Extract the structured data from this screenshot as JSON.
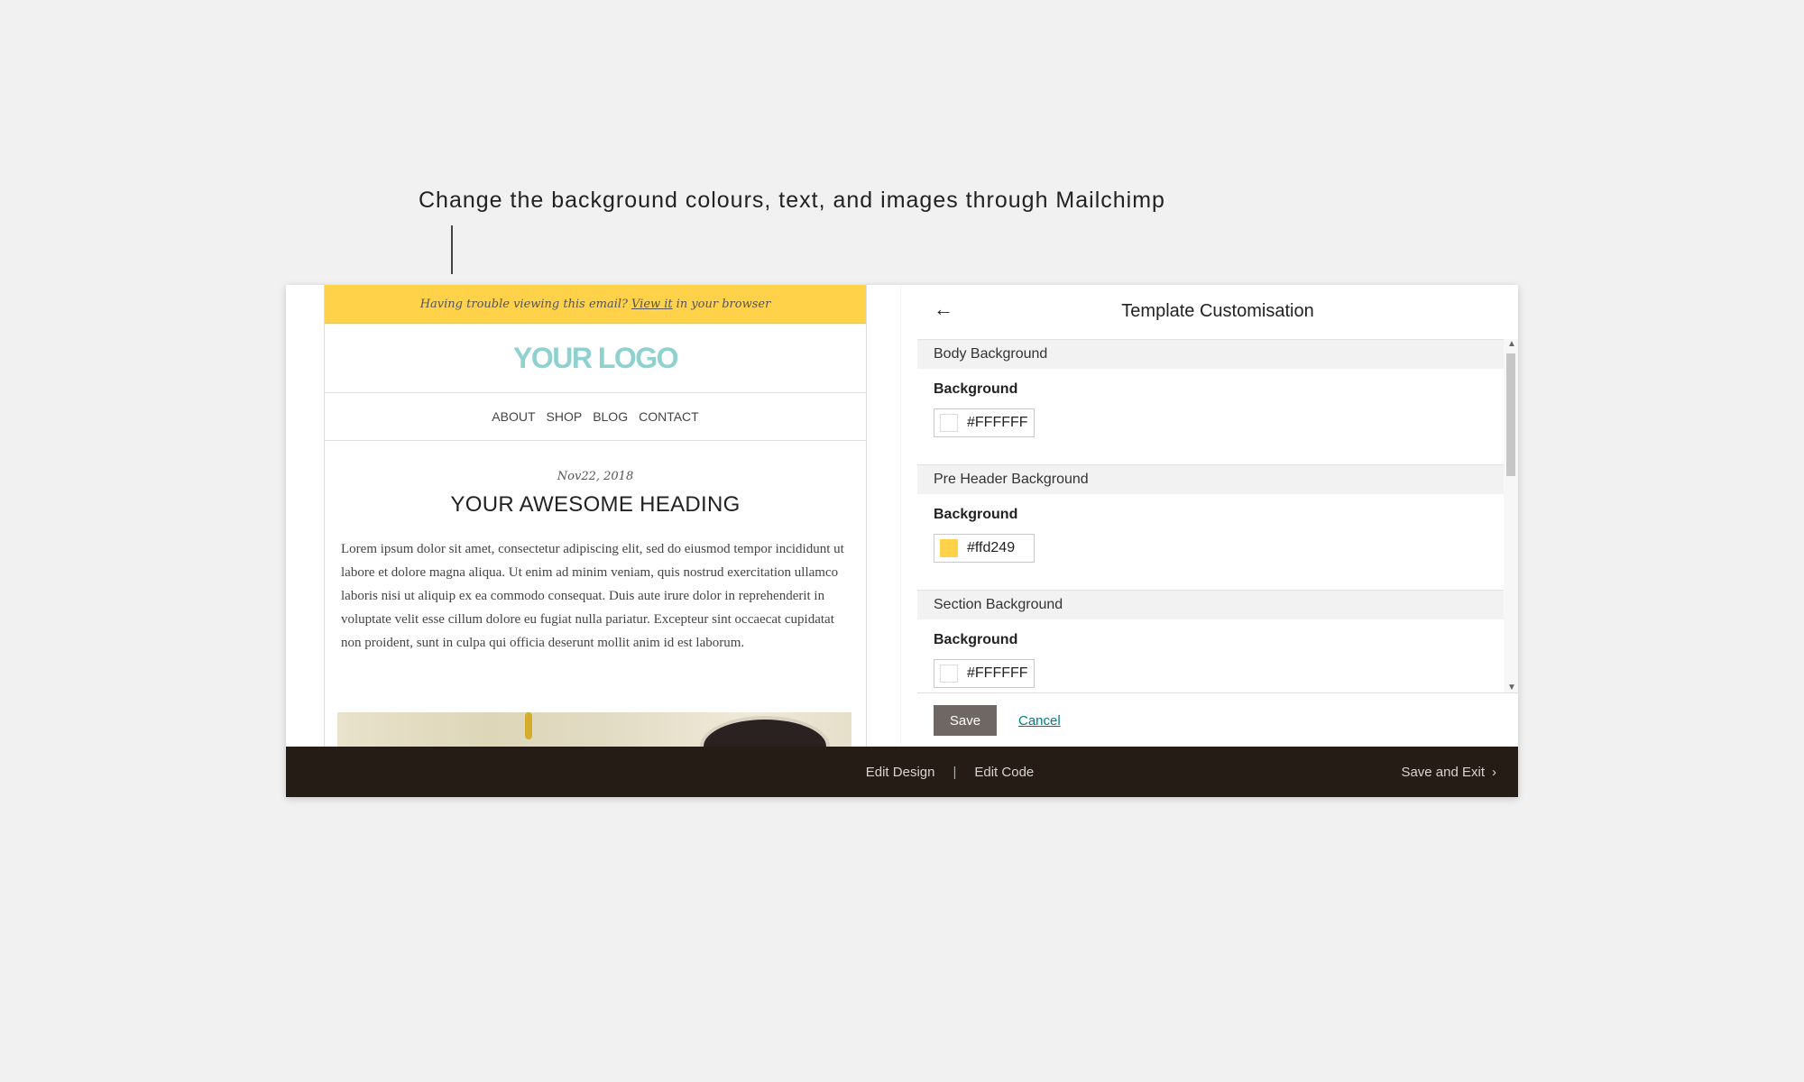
{
  "callout": {
    "text": "Change the background colours, text, and images through Mailchimp"
  },
  "preview": {
    "preheader": {
      "before_link": "Having trouble viewing this email?",
      "link": "View it",
      "after_link": "in your browser"
    },
    "logo": "YOUR LOGO",
    "nav": [
      "ABOUT",
      "SHOP",
      "BLOG",
      "CONTACT"
    ],
    "date": "Nov22, 2018",
    "heading": "YOUR AWESOME HEADING",
    "body": "Lorem ipsum dolor sit amet, consectetur adipiscing elit, sed do eiusmod tempor incididunt ut labore et dolore magna aliqua. Ut enim ad minim veniam, quis nostrud exercitation ullamco laboris nisi ut aliquip ex ea commodo consequat. Duis aute irure dolor in reprehenderit in voluptate velit esse cillum dolore eu fugiat nulla pariatur. Excepteur sint occaecat cupidatat non proident, sunt in culpa qui officia deserunt mollit anim id est laborum."
  },
  "panel": {
    "title": "Template Customisation",
    "back_icon": "arrow-left-icon",
    "sections": [
      {
        "title": "Body Background",
        "label": "Background",
        "value": "#FFFFFF",
        "swatch": "#FFFFFF"
      },
      {
        "title": "Pre Header Background",
        "label": "Background",
        "value": "#ffd249",
        "swatch": "#ffd249"
      },
      {
        "title": "Section Background",
        "label": "Background",
        "value": "#FFFFFF",
        "swatch": "#FFFFFF"
      }
    ],
    "save_label": "Save",
    "cancel_label": "Cancel"
  },
  "bottom_bar": {
    "edit_design": "Edit Design",
    "separator": "|",
    "edit_code": "Edit Code",
    "save_exit": "Save and Exit",
    "save_exit_icon": "chevron-right-icon"
  },
  "colors": {
    "preheader": "#ffd249",
    "logo": "#8fd1cf",
    "bottom_bar": "#241c15",
    "save_button": "#6f6764",
    "cancel_link": "#007c89"
  }
}
